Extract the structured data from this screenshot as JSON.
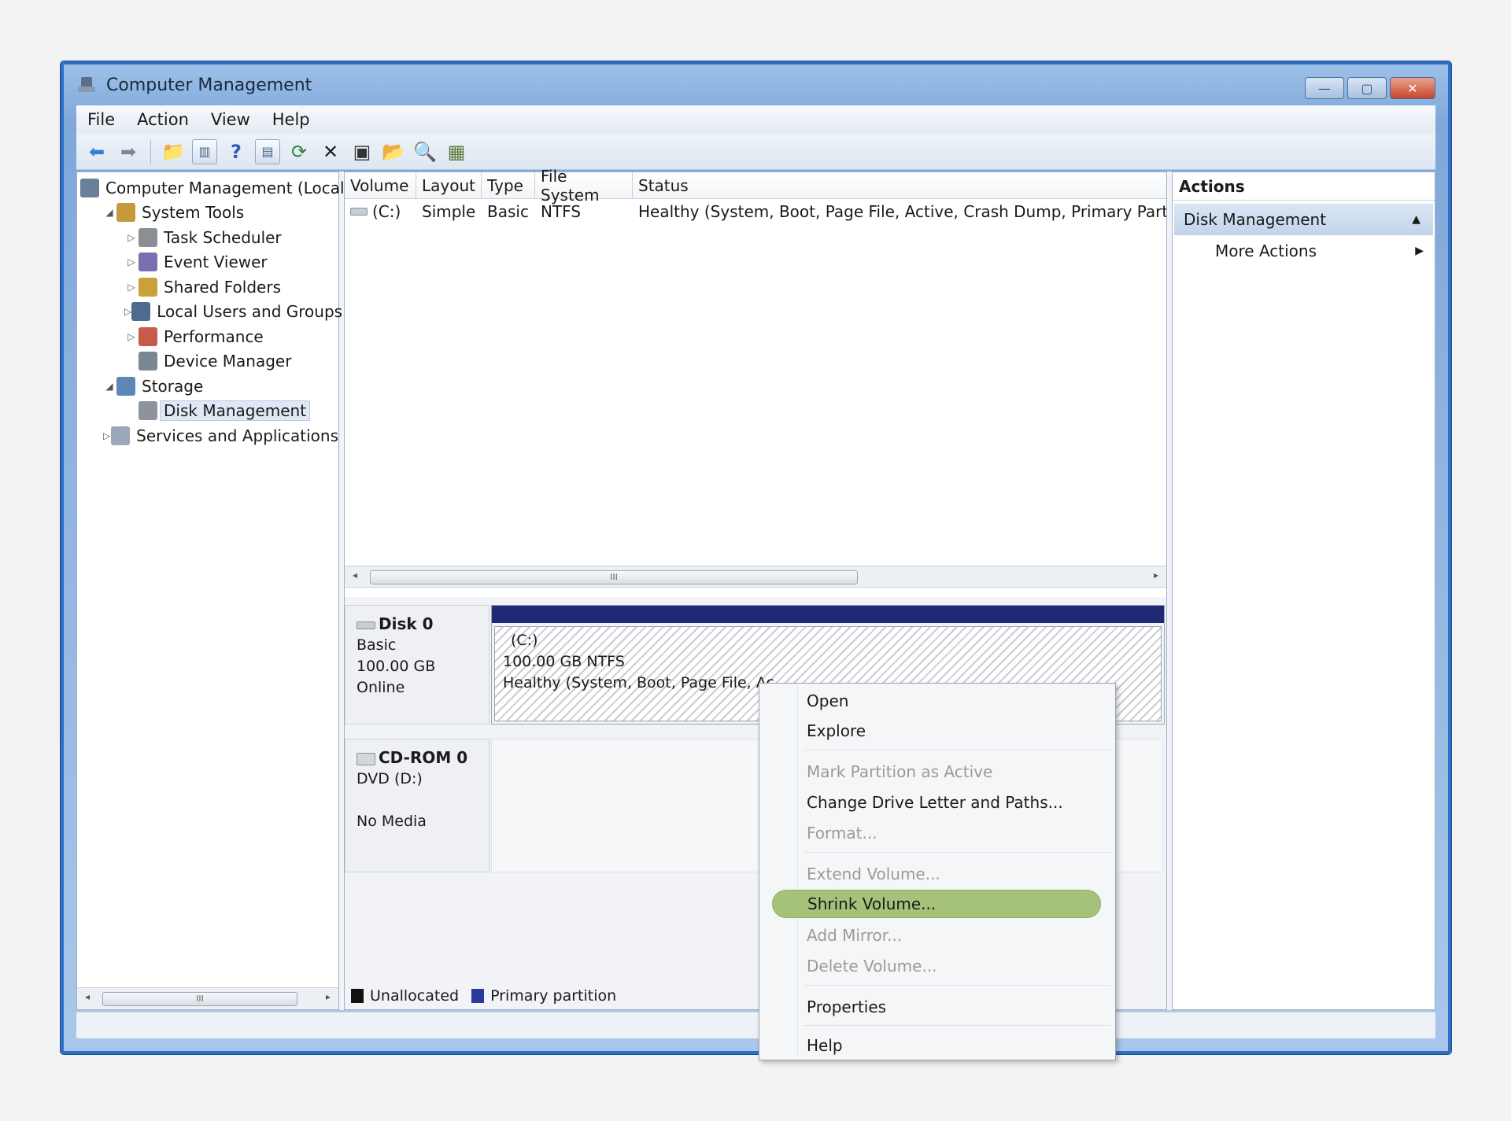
{
  "window": {
    "title": "Computer Management",
    "controls": {
      "minimize": "—",
      "maximize": "▢",
      "close": "✕"
    }
  },
  "menu": [
    "File",
    "Action",
    "View",
    "Help"
  ],
  "toolbar_icons": [
    "back-arrow-icon",
    "forward-arrow-icon",
    "up-folder-icon",
    "show-hide-console-tree-icon",
    "help-icon",
    "show-hide-action-pane-icon",
    "refresh-icon",
    "delete-icon",
    "properties-icon",
    "open-folder-icon",
    "search-icon",
    "disk-properties-icon"
  ],
  "tree": [
    {
      "label": "Computer Management (Local",
      "level": 0,
      "arrow": ""
    },
    {
      "label": "System Tools",
      "level": 1,
      "arrow": "◢"
    },
    {
      "label": "Task Scheduler",
      "level": 2,
      "arrow": "▷"
    },
    {
      "label": "Event Viewer",
      "level": 2,
      "arrow": "▷"
    },
    {
      "label": "Shared Folders",
      "level": 2,
      "arrow": "▷"
    },
    {
      "label": "Local Users and Groups",
      "level": 2,
      "arrow": "▷"
    },
    {
      "label": "Performance",
      "level": 2,
      "arrow": "▷"
    },
    {
      "label": "Device Manager",
      "level": 2,
      "arrow": ""
    },
    {
      "label": "Storage",
      "level": 1,
      "arrow": "◢"
    },
    {
      "label": "Disk Management",
      "level": 2,
      "arrow": "",
      "selected": true
    },
    {
      "label": "Services and Applications",
      "level": 1,
      "arrow": "▷"
    }
  ],
  "volume_list": {
    "columns": [
      "Volume",
      "Layout",
      "Type",
      "File System",
      "Status"
    ],
    "rows": [
      {
        "volume": "(C:)",
        "layout": "Simple",
        "type": "Basic",
        "fs": "NTFS",
        "status": "Healthy (System, Boot, Page File, Active, Crash Dump, Primary Partition"
      }
    ],
    "scroll_grip": "III"
  },
  "disks": [
    {
      "name": "Disk 0",
      "lines": [
        "Basic",
        "100.00 GB",
        "Online"
      ]
    },
    {
      "name": "CD-ROM 0",
      "lines": [
        "DVD (D:)",
        "",
        "No Media"
      ]
    }
  ],
  "partition": {
    "name": "(C:)",
    "size": "100.00 GB NTFS",
    "status": "Healthy (System, Boot, Page File, Ac"
  },
  "legend": [
    {
      "label": "Unallocated",
      "color": "#111111"
    },
    {
      "label": "Primary partition",
      "color": "#2a3a9a"
    }
  ],
  "actions": {
    "header": "Actions",
    "section": "Disk Management",
    "more": "More Actions"
  },
  "context_menu": [
    {
      "label": "Open",
      "enabled": true
    },
    {
      "label": "Explore",
      "enabled": true
    },
    {
      "label": "Mark Partition as Active",
      "enabled": false
    },
    {
      "label": "Change Drive Letter and Paths...",
      "enabled": true
    },
    {
      "label": "Format...",
      "enabled": false
    },
    {
      "label": "Extend Volume...",
      "enabled": false
    },
    {
      "label": "Shrink Volume...",
      "enabled": true,
      "highlighted": true
    },
    {
      "label": "Add Mirror...",
      "enabled": false
    },
    {
      "label": "Delete Volume...",
      "enabled": false
    },
    {
      "label": "Properties",
      "enabled": true
    },
    {
      "label": "Help",
      "enabled": true
    }
  ],
  "colors": {
    "title_bar": "#7fa8d9",
    "disk_bar": "#1e2a78",
    "highlight": "#a6c27a"
  }
}
